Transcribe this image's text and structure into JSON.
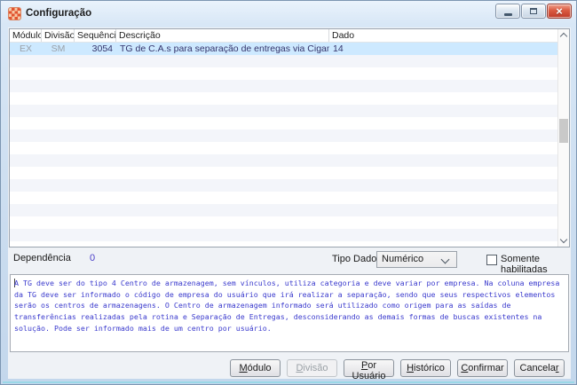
{
  "window": {
    "title": "Configuração"
  },
  "icons": {
    "app_icon": "cigam-grid-logo",
    "minimize": "minimize-bar",
    "maximize": "restore-square",
    "close_glyph": "×",
    "combo_chevron": "chevron-down",
    "scroll_up": "chevron-up",
    "scroll_down": "chevron-down"
  },
  "grid": {
    "columns": [
      "Módulo",
      "Divisão",
      "Sequência",
      "Descrição",
      "Dado"
    ],
    "rows": [
      [
        "EX",
        "SM",
        "3054",
        "TG de C.A.s para separação de entregas via Cigam Coletor",
        "14"
      ]
    ],
    "selected_row_index": 0
  },
  "fields": {
    "dependencia_label": "Dependência",
    "dependencia_value": "0",
    "tipo_dado_label": "Tipo Dado",
    "tipo_dado_value": "Numérico",
    "somente_habilitadas_label": "Somente habilitadas",
    "somente_habilitadas_checked": false
  },
  "memo": {
    "text": "A TG deve ser do tipo 4 Centro de armazenagem, sem vínculos, utiliza categoria e deve variar por empresa. Na coluna empresa\nda TG deve ser informado o código de empresa do usuário que irá realizar a separação, sendo que seus respectivos elementos\nserão os centros de armazenagens. O Centro de armazenagem informado será utilizado como origem para as saídas de\ntransferências realizadas pela rotina e Separação de Entregas, desconsiderando as demais formas de buscas existentes na\nsolução. Pode ser informado mais de um centro por usuário."
  },
  "buttons": [
    {
      "label": "Módulo",
      "underline_index": 0,
      "disabled": false
    },
    {
      "label": "Divisão",
      "underline_index": 0,
      "disabled": true
    },
    {
      "label": "Por Usuário",
      "underline_index": 0,
      "disabled": false
    },
    {
      "label": "Histórico",
      "underline_index": 0,
      "disabled": false
    },
    {
      "label": "Confirmar",
      "underline_index": 0,
      "disabled": false
    },
    {
      "label": "Cancelar",
      "underline_index": 7,
      "disabled": false
    }
  ],
  "colors": {
    "selection_row": "#cde9ff",
    "memo_text": "#3a3acd",
    "dependencia_value": "#4a3fc8",
    "close_button": "#bf3b28",
    "titlebar": "#d8e7f6"
  }
}
